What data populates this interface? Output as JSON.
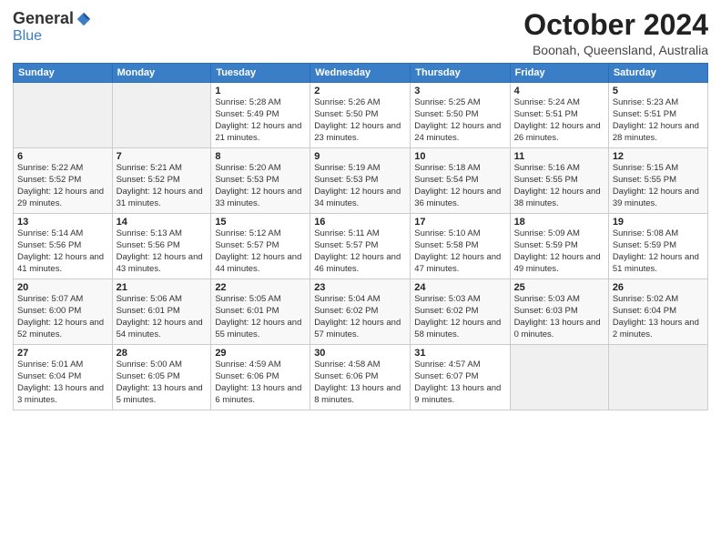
{
  "logo": {
    "general": "General",
    "blue": "Blue"
  },
  "header": {
    "month": "October 2024",
    "location": "Boonah, Queensland, Australia"
  },
  "weekdays": [
    "Sunday",
    "Monday",
    "Tuesday",
    "Wednesday",
    "Thursday",
    "Friday",
    "Saturday"
  ],
  "weeks": [
    [
      {
        "day": "",
        "sunrise": "",
        "sunset": "",
        "daylight": ""
      },
      {
        "day": "",
        "sunrise": "",
        "sunset": "",
        "daylight": ""
      },
      {
        "day": "1",
        "sunrise": "Sunrise: 5:28 AM",
        "sunset": "Sunset: 5:49 PM",
        "daylight": "Daylight: 12 hours and 21 minutes."
      },
      {
        "day": "2",
        "sunrise": "Sunrise: 5:26 AM",
        "sunset": "Sunset: 5:50 PM",
        "daylight": "Daylight: 12 hours and 23 minutes."
      },
      {
        "day": "3",
        "sunrise": "Sunrise: 5:25 AM",
        "sunset": "Sunset: 5:50 PM",
        "daylight": "Daylight: 12 hours and 24 minutes."
      },
      {
        "day": "4",
        "sunrise": "Sunrise: 5:24 AM",
        "sunset": "Sunset: 5:51 PM",
        "daylight": "Daylight: 12 hours and 26 minutes."
      },
      {
        "day": "5",
        "sunrise": "Sunrise: 5:23 AM",
        "sunset": "Sunset: 5:51 PM",
        "daylight": "Daylight: 12 hours and 28 minutes."
      }
    ],
    [
      {
        "day": "6",
        "sunrise": "Sunrise: 5:22 AM",
        "sunset": "Sunset: 5:52 PM",
        "daylight": "Daylight: 12 hours and 29 minutes."
      },
      {
        "day": "7",
        "sunrise": "Sunrise: 5:21 AM",
        "sunset": "Sunset: 5:52 PM",
        "daylight": "Daylight: 12 hours and 31 minutes."
      },
      {
        "day": "8",
        "sunrise": "Sunrise: 5:20 AM",
        "sunset": "Sunset: 5:53 PM",
        "daylight": "Daylight: 12 hours and 33 minutes."
      },
      {
        "day": "9",
        "sunrise": "Sunrise: 5:19 AM",
        "sunset": "Sunset: 5:53 PM",
        "daylight": "Daylight: 12 hours and 34 minutes."
      },
      {
        "day": "10",
        "sunrise": "Sunrise: 5:18 AM",
        "sunset": "Sunset: 5:54 PM",
        "daylight": "Daylight: 12 hours and 36 minutes."
      },
      {
        "day": "11",
        "sunrise": "Sunrise: 5:16 AM",
        "sunset": "Sunset: 5:55 PM",
        "daylight": "Daylight: 12 hours and 38 minutes."
      },
      {
        "day": "12",
        "sunrise": "Sunrise: 5:15 AM",
        "sunset": "Sunset: 5:55 PM",
        "daylight": "Daylight: 12 hours and 39 minutes."
      }
    ],
    [
      {
        "day": "13",
        "sunrise": "Sunrise: 5:14 AM",
        "sunset": "Sunset: 5:56 PM",
        "daylight": "Daylight: 12 hours and 41 minutes."
      },
      {
        "day": "14",
        "sunrise": "Sunrise: 5:13 AM",
        "sunset": "Sunset: 5:56 PM",
        "daylight": "Daylight: 12 hours and 43 minutes."
      },
      {
        "day": "15",
        "sunrise": "Sunrise: 5:12 AM",
        "sunset": "Sunset: 5:57 PM",
        "daylight": "Daylight: 12 hours and 44 minutes."
      },
      {
        "day": "16",
        "sunrise": "Sunrise: 5:11 AM",
        "sunset": "Sunset: 5:57 PM",
        "daylight": "Daylight: 12 hours and 46 minutes."
      },
      {
        "day": "17",
        "sunrise": "Sunrise: 5:10 AM",
        "sunset": "Sunset: 5:58 PM",
        "daylight": "Daylight: 12 hours and 47 minutes."
      },
      {
        "day": "18",
        "sunrise": "Sunrise: 5:09 AM",
        "sunset": "Sunset: 5:59 PM",
        "daylight": "Daylight: 12 hours and 49 minutes."
      },
      {
        "day": "19",
        "sunrise": "Sunrise: 5:08 AM",
        "sunset": "Sunset: 5:59 PM",
        "daylight": "Daylight: 12 hours and 51 minutes."
      }
    ],
    [
      {
        "day": "20",
        "sunrise": "Sunrise: 5:07 AM",
        "sunset": "Sunset: 6:00 PM",
        "daylight": "Daylight: 12 hours and 52 minutes."
      },
      {
        "day": "21",
        "sunrise": "Sunrise: 5:06 AM",
        "sunset": "Sunset: 6:01 PM",
        "daylight": "Daylight: 12 hours and 54 minutes."
      },
      {
        "day": "22",
        "sunrise": "Sunrise: 5:05 AM",
        "sunset": "Sunset: 6:01 PM",
        "daylight": "Daylight: 12 hours and 55 minutes."
      },
      {
        "day": "23",
        "sunrise": "Sunrise: 5:04 AM",
        "sunset": "Sunset: 6:02 PM",
        "daylight": "Daylight: 12 hours and 57 minutes."
      },
      {
        "day": "24",
        "sunrise": "Sunrise: 5:03 AM",
        "sunset": "Sunset: 6:02 PM",
        "daylight": "Daylight: 12 hours and 58 minutes."
      },
      {
        "day": "25",
        "sunrise": "Sunrise: 5:03 AM",
        "sunset": "Sunset: 6:03 PM",
        "daylight": "Daylight: 13 hours and 0 minutes."
      },
      {
        "day": "26",
        "sunrise": "Sunrise: 5:02 AM",
        "sunset": "Sunset: 6:04 PM",
        "daylight": "Daylight: 13 hours and 2 minutes."
      }
    ],
    [
      {
        "day": "27",
        "sunrise": "Sunrise: 5:01 AM",
        "sunset": "Sunset: 6:04 PM",
        "daylight": "Daylight: 13 hours and 3 minutes."
      },
      {
        "day": "28",
        "sunrise": "Sunrise: 5:00 AM",
        "sunset": "Sunset: 6:05 PM",
        "daylight": "Daylight: 13 hours and 5 minutes."
      },
      {
        "day": "29",
        "sunrise": "Sunrise: 4:59 AM",
        "sunset": "Sunset: 6:06 PM",
        "daylight": "Daylight: 13 hours and 6 minutes."
      },
      {
        "day": "30",
        "sunrise": "Sunrise: 4:58 AM",
        "sunset": "Sunset: 6:06 PM",
        "daylight": "Daylight: 13 hours and 8 minutes."
      },
      {
        "day": "31",
        "sunrise": "Sunrise: 4:57 AM",
        "sunset": "Sunset: 6:07 PM",
        "daylight": "Daylight: 13 hours and 9 minutes."
      },
      {
        "day": "",
        "sunrise": "",
        "sunset": "",
        "daylight": ""
      },
      {
        "day": "",
        "sunrise": "",
        "sunset": "",
        "daylight": ""
      }
    ]
  ]
}
